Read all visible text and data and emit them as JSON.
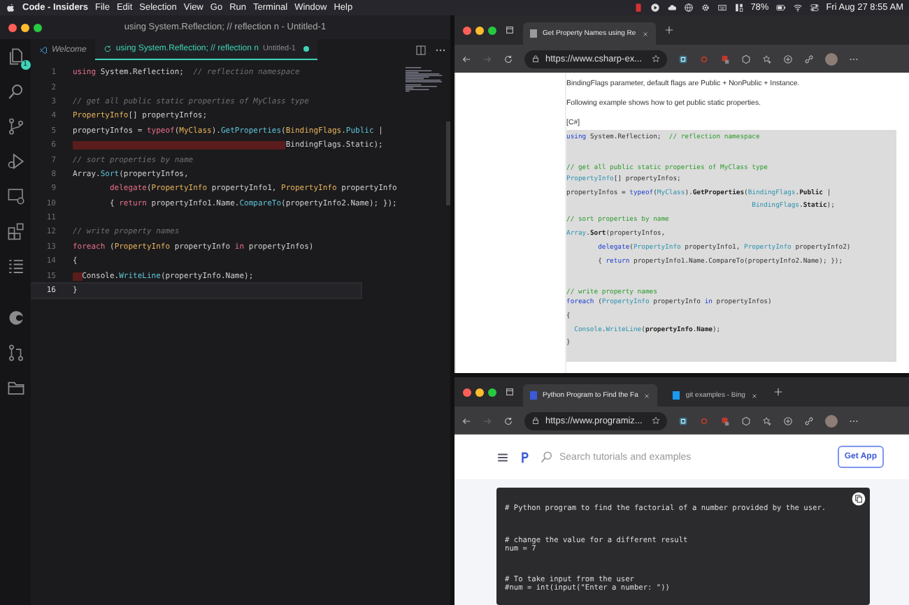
{
  "menubar": {
    "app": "Code - Insiders",
    "menus": [
      "File",
      "Edit",
      "Selection",
      "View",
      "Go",
      "Run",
      "Terminal",
      "Window",
      "Help"
    ],
    "battery": "78%",
    "clock": "Fri Aug 27  8:55 AM"
  },
  "editor": {
    "title": "using System.Reflection; // reflection n - Untitled-1",
    "explorer_badge": "1",
    "tabs": [
      {
        "label": "Welcome",
        "selected": false,
        "modified": false
      },
      {
        "label": "using System.Reflection; // reflection n",
        "description": "Untitled-1",
        "selected": true,
        "modified": true
      }
    ],
    "lines": [
      {
        "number": "1",
        "current": false,
        "indent_error": false,
        "tokens": [
          {
            "kind": "kw",
            "text": "using"
          },
          {
            "kind": "pl",
            "text": " System.Reflection;  "
          },
          {
            "kind": "cm",
            "text": "// reflection namespace"
          }
        ]
      },
      {
        "number": "2",
        "current": false
      },
      {
        "number": "3",
        "current": false,
        "indent_error": false,
        "tokens": [
          {
            "kind": "cm",
            "text": "// get all public static properties of MyClass type"
          }
        ]
      },
      {
        "number": "4",
        "current": false,
        "indent_error": false,
        "tokens": [
          {
            "kind": "ty",
            "text": "PropertyInfo"
          },
          {
            "kind": "pl",
            "text": "[] propertyInfos;"
          }
        ]
      },
      {
        "number": "5",
        "current": false,
        "indent_error": false,
        "tokens": [
          {
            "kind": "pl",
            "text": "propertyInfos = "
          },
          {
            "kind": "kw",
            "text": "typeof"
          },
          {
            "kind": "pl",
            "text": "("
          },
          {
            "kind": "ty",
            "text": "MyClass"
          },
          {
            "kind": "pl",
            "text": ")."
          },
          {
            "kind": "fn",
            "text": "GetProperties"
          },
          {
            "kind": "pl",
            "text": "("
          },
          {
            "kind": "ty",
            "text": "BindingFlags"
          },
          {
            "kind": "pl",
            "text": "."
          },
          {
            "kind": "fn",
            "text": "Public"
          },
          {
            "kind": "pl",
            "text": " |"
          }
        ]
      },
      {
        "number": "6",
        "current": false,
        "indent_error": true,
        "tokens": [
          {
            "kind": "pl",
            "text": "                                              BindingFlags.Static);"
          }
        ]
      },
      {
        "number": "7",
        "current": false,
        "indent_error": false,
        "tokens": [
          {
            "kind": "cm",
            "text": "// sort properties by name"
          }
        ]
      },
      {
        "number": "8",
        "current": false,
        "indent_error": false,
        "tokens": [
          {
            "kind": "pl",
            "text": "Array."
          },
          {
            "kind": "fn",
            "text": "Sort"
          },
          {
            "kind": "pl",
            "text": "(propertyInfos,"
          }
        ]
      },
      {
        "number": "9",
        "current": false,
        "indent_error": false,
        "tokens": [
          {
            "kind": "kw",
            "text": "        delegate"
          },
          {
            "kind": "pl",
            "text": "("
          },
          {
            "kind": "ty",
            "text": "PropertyInfo"
          },
          {
            "kind": "pl",
            "text": " propertyInfo1, "
          },
          {
            "kind": "ty",
            "text": "PropertyInfo"
          },
          {
            "kind": "pl",
            "text": " propertyInfo"
          }
        ]
      },
      {
        "number": "10",
        "current": false,
        "indent_error": false,
        "tokens": [
          {
            "kind": "pl",
            "text": "        { "
          },
          {
            "kind": "kw",
            "text": "return"
          },
          {
            "kind": "pl",
            "text": " propertyInfo1.Name."
          },
          {
            "kind": "fn",
            "text": "CompareTo"
          },
          {
            "kind": "pl",
            "text": "(propertyInfo2.Name); });"
          }
        ]
      },
      {
        "number": "11",
        "current": false
      },
      {
        "number": "12",
        "current": false,
        "indent_error": false,
        "tokens": [
          {
            "kind": "cm",
            "text": "// write property names"
          }
        ]
      },
      {
        "number": "13",
        "current": false,
        "indent_error": false,
        "tokens": [
          {
            "kind": "kw",
            "text": "foreach"
          },
          {
            "kind": "pl",
            "text": " ("
          },
          {
            "kind": "ty",
            "text": "PropertyInfo"
          },
          {
            "kind": "pl",
            "text": " propertyInfo "
          },
          {
            "kind": "kw",
            "text": "in"
          },
          {
            "kind": "pl",
            "text": " propertyInfos)"
          }
        ]
      },
      {
        "number": "14",
        "current": false,
        "indent_error": false,
        "tokens": [
          {
            "kind": "pl",
            "text": "{"
          }
        ]
      },
      {
        "number": "15",
        "current": false,
        "indent_error": true,
        "tokens": [
          {
            "kind": "pl",
            "text": "  Console."
          },
          {
            "kind": "fn",
            "text": "WriteLine"
          },
          {
            "kind": "pl",
            "text": "(propertyInfo.Name);"
          }
        ]
      },
      {
        "number": "16",
        "current": true,
        "indent_error": false,
        "tokens": [
          {
            "kind": "pl",
            "text": "}"
          }
        ]
      }
    ]
  },
  "browser_top": {
    "tabs": [
      {
        "label": "Get Property Names using Re",
        "selected": true,
        "color": "#9a9a9a"
      }
    ],
    "url": "https://www.csharp-ex...",
    "paragraphs": [
      "BindingFlags parameter, default flags are Public + NonPublic + Instance.",
      "Following example shows how to get public static properties."
    ],
    "code_label": "[C#]",
    "code": [
      {
        "gap_before": false,
        "tokens": [
          {
            "kind": "kw",
            "text": "using"
          },
          {
            "kind": "pl",
            "text": " System.Reflection;  "
          },
          {
            "kind": "cm",
            "text": "// reflection namespace"
          }
        ]
      },
      {
        "gap_before": true,
        "tokens": [
          {
            "kind": "cm",
            "text": "// get all public static properties of MyClass type"
          }
        ]
      },
      {
        "gap_before": false,
        "tokens": [
          {
            "kind": "ty",
            "text": "PropertyInfo"
          },
          {
            "kind": "pl",
            "text": "[] propertyInfos;"
          }
        ]
      },
      {
        "gap_before": false,
        "tokens": [
          {
            "kind": "pl",
            "text": "propertyInfos = "
          },
          {
            "kind": "kw",
            "text": "typeof"
          },
          {
            "kind": "pl",
            "text": "("
          },
          {
            "kind": "ty",
            "text": "MyClass"
          },
          {
            "kind": "pl",
            "text": ")."
          },
          {
            "kind": "b",
            "text": "GetProperties"
          },
          {
            "kind": "pl",
            "text": "("
          },
          {
            "kind": "ty",
            "text": "BindingFlags"
          },
          {
            "kind": "pl",
            "text": "."
          },
          {
            "kind": "b",
            "text": "Public"
          },
          {
            "kind": "pl",
            "text": " |"
          }
        ]
      },
      {
        "gap_before": false,
        "tokens": [
          {
            "kind": "ty",
            "text": "                                               BindingFlags"
          },
          {
            "kind": "pl",
            "text": "."
          },
          {
            "kind": "b",
            "text": "Static"
          },
          {
            "kind": "pl",
            "text": ");"
          }
        ]
      },
      {
        "gap_before": false,
        "tokens": [
          {
            "kind": "cm",
            "text": "// sort properties by name"
          }
        ]
      },
      {
        "gap_before": false,
        "tokens": [
          {
            "kind": "ty",
            "text": "Array"
          },
          {
            "kind": "pl",
            "text": "."
          },
          {
            "kind": "b",
            "text": "Sort"
          },
          {
            "kind": "pl",
            "text": "(propertyInfos,"
          }
        ]
      },
      {
        "gap_before": false,
        "tokens": [
          {
            "kind": "kw",
            "text": "        delegate"
          },
          {
            "kind": "pl",
            "text": "("
          },
          {
            "kind": "ty",
            "text": "PropertyInfo"
          },
          {
            "kind": "pl",
            "text": " propertyInfo1, "
          },
          {
            "kind": "ty",
            "text": "PropertyInfo"
          },
          {
            "kind": "pl",
            "text": " propertyInfo2)"
          }
        ]
      },
      {
        "gap_before": false,
        "tokens": [
          {
            "kind": "pl",
            "text": "        { "
          },
          {
            "kind": "kw",
            "text": "return"
          },
          {
            "kind": "pl",
            "text": " propertyInfo1.Name.CompareTo(propertyInfo2.Name); });"
          }
        ]
      },
      {
        "gap_before": true,
        "tokens": [
          {
            "kind": "cm",
            "text": "// write property names"
          }
        ]
      },
      {
        "gap_before": false,
        "tokens": [
          {
            "kind": "kw",
            "text": "foreach"
          },
          {
            "kind": "pl",
            "text": " ("
          },
          {
            "kind": "ty",
            "text": "PropertyInfo"
          },
          {
            "kind": "pl",
            "text": " propertyInfo "
          },
          {
            "kind": "kw",
            "text": "in"
          },
          {
            "kind": "pl",
            "text": " propertyInfos)"
          }
        ]
      },
      {
        "gap_before": false,
        "tokens": [
          {
            "kind": "pl",
            "text": "{"
          }
        ]
      },
      {
        "gap_before": false,
        "tokens": [
          {
            "kind": "ty",
            "text": "  Console"
          },
          {
            "kind": "pl",
            "text": "."
          },
          {
            "kind": "ty",
            "text": "WriteLine"
          },
          {
            "kind": "pl",
            "text": "("
          },
          {
            "kind": "b",
            "text": "propertyInfo"
          },
          {
            "kind": "pl",
            "text": "."
          },
          {
            "kind": "b",
            "text": "Name"
          },
          {
            "kind": "pl",
            "text": ");"
          }
        ]
      },
      {
        "gap_before": false,
        "tokens": [
          {
            "kind": "pl",
            "text": "}"
          }
        ]
      }
    ]
  },
  "browser_bottom": {
    "tabs": [
      {
        "label": "Python Program to Find the Fa",
        "selected": true,
        "color": "#3b5bdb"
      },
      {
        "label": "git examples - Bing",
        "selected": false,
        "color": "#1a9bf0"
      }
    ],
    "url": "https://www.programiz...",
    "search": {
      "placeholder": "Search tutorials and examples"
    },
    "get_app": "Get App",
    "code": [
      {
        "gap_before": false,
        "text": "# Python program to find the factorial of a number provided by the user."
      },
      {
        "gap_before": true,
        "text": "# change the value for a different result"
      },
      {
        "gap_before": false,
        "text": "num = 7"
      },
      {
        "gap_before": true,
        "text": "# To take input from the user"
      },
      {
        "gap_before": false,
        "text": "#num = int(input(\"Enter a number: \"))"
      }
    ]
  }
}
